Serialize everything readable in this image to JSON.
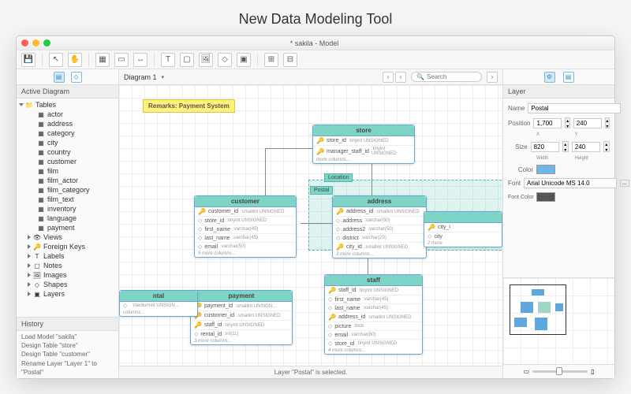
{
  "page_title": "New Data Modeling Tool",
  "window_title": "* sakila - Model",
  "toolbar_icons": [
    "save",
    "pointer",
    "hand",
    "table",
    "view",
    "foreign-key",
    "label",
    "note",
    "image",
    "shape",
    "layer",
    "align",
    "auto-layout"
  ],
  "diagram_selector": "Diagram 1",
  "search": {
    "placeholder": "Search"
  },
  "sidebar": {
    "active_diagram_label": "Active Diagram",
    "root": "Tables",
    "tables": [
      "actor",
      "address",
      "category",
      "city",
      "country",
      "customer",
      "film",
      "film_actor",
      "film_category",
      "film_text",
      "inventory",
      "language",
      "payment"
    ],
    "groups": [
      "Views",
      "Foreign Keys",
      "Labels",
      "Notes",
      "Images",
      "Shapes",
      "Layers"
    ]
  },
  "history": {
    "label": "History",
    "items": [
      "Load Model \"sakila\"",
      "Design Table \"store\"",
      "Design Table \"customer\"",
      "Rename Layer \"Layer 1\" to \"Postal\""
    ]
  },
  "remark": "Remarks: Payment System",
  "layer_region": {
    "label_top": "Location",
    "label_bottom": "Postal"
  },
  "entities": {
    "store": {
      "title": "store",
      "rows": [
        {
          "icon": "key",
          "name": "store_id",
          "type": "tinyint UNSIGNED"
        },
        {
          "icon": "key",
          "name": "manager_staff_id",
          "type": "tinyint UNSIGNED"
        }
      ],
      "more": "more columns..."
    },
    "customer": {
      "title": "customer",
      "rows": [
        {
          "icon": "key",
          "name": "customer_id",
          "type": "smallint UNSIGNED"
        },
        {
          "icon": "diamond",
          "name": "store_id",
          "type": "tinyint UNSIGNED"
        },
        {
          "icon": "diamond",
          "name": "first_name",
          "type": "varchar(45)"
        },
        {
          "icon": "diamond",
          "name": "last_name",
          "type": "varchar(45)"
        },
        {
          "icon": "diamond",
          "name": "email",
          "type": "varchar(50)"
        }
      ],
      "more": "5 more columns..."
    },
    "address": {
      "title": "address",
      "rows": [
        {
          "icon": "key",
          "name": "address_id",
          "type": "smallint UNSIGNED"
        },
        {
          "icon": "diamond",
          "name": "address",
          "type": "varchar(50)"
        },
        {
          "icon": "diamond",
          "name": "address2",
          "type": "varchar(50)"
        },
        {
          "icon": "diamond",
          "name": "district",
          "type": "varchar(20)"
        },
        {
          "icon": "key",
          "name": "city_id",
          "type": "smallint UNSIGNED"
        }
      ],
      "more": "3 more columns..."
    },
    "staff": {
      "title": "staff",
      "rows": [
        {
          "icon": "key",
          "name": "staff_id",
          "type": "tinyint UNSIGNED"
        },
        {
          "icon": "diamond",
          "name": "first_name",
          "type": "varchar(45)"
        },
        {
          "icon": "diamond",
          "name": "last_name",
          "type": "varchar(45)"
        },
        {
          "icon": "key",
          "name": "address_id",
          "type": "smallint UNSIGNED"
        },
        {
          "icon": "diamond",
          "name": "picture",
          "type": "blob"
        },
        {
          "icon": "diamond",
          "name": "email",
          "type": "varchar(50)"
        },
        {
          "icon": "diamond",
          "name": "store_id",
          "type": "tinyint UNSIGNED"
        }
      ],
      "more": "4 more columns..."
    },
    "payment": {
      "title": "payment",
      "rows": [
        {
          "icon": "key",
          "name": "payment_id",
          "type": "smallint UNSIGN..."
        },
        {
          "icon": "key",
          "name": "customer_id",
          "type": "smallint UNSIGNED"
        },
        {
          "icon": "key",
          "name": "staff_id",
          "type": "tinyint UNSIGNED"
        },
        {
          "icon": "diamond",
          "name": "rental_id",
          "type": "int(11)"
        }
      ],
      "more": "3 more columns..."
    },
    "rental": {
      "title": "ntal",
      "rows": [
        {
          "icon": "diamond",
          "name": "",
          "type": "mediumint UNSIGN..."
        }
      ],
      "more": "columns..."
    },
    "city": {
      "title": "",
      "rows": [
        {
          "icon": "key",
          "name": "city_i",
          "type": ""
        },
        {
          "icon": "diamond",
          "name": "city",
          "type": ""
        }
      ],
      "more": "2 more"
    }
  },
  "inspector": {
    "title": "Layer",
    "name_label": "Name",
    "name_value": "Postal",
    "position_label": "Position",
    "pos_x": "1,700",
    "pos_y": "240",
    "x_label": "X",
    "y_label": "Y",
    "size_label": "Size",
    "width": "820",
    "height": "240",
    "w_label": "Width",
    "h_label": "Height",
    "color_label": "Color",
    "color_value": "#6fb7e8",
    "font_label": "Font",
    "font_value": "Arial Unicode MS 14.0",
    "font_color_label": "Font Color",
    "font_color_value": "#555555"
  },
  "status": "Layer \"Postal\" is selected."
}
